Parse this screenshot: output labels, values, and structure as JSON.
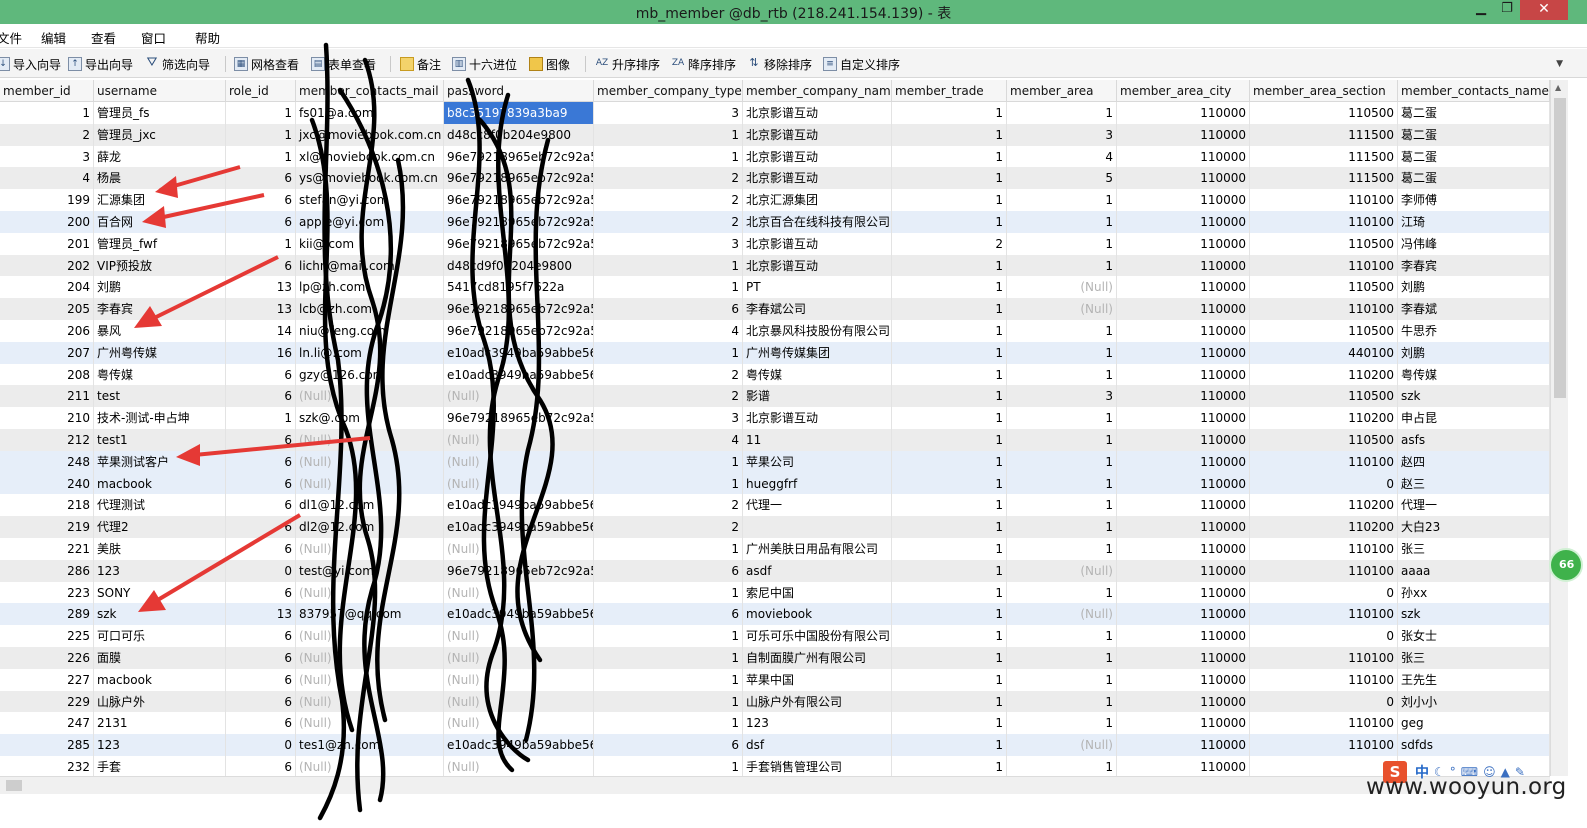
{
  "window": {
    "title": "mb_member @db_rtb (218.241.154.139) - 表",
    "min_label": "▁",
    "max_label": "❐",
    "close_label": "✕"
  },
  "menu": [
    "文件",
    "编辑",
    "查看",
    "窗口",
    "帮助"
  ],
  "toolbar": {
    "items": [
      "导入向导",
      "导出向导",
      "筛选向导",
      "网格查看",
      "表单查看",
      "备注",
      "十六进位",
      "图像",
      "升序排序",
      "降序排序",
      "移除排序",
      "自定义排序"
    ]
  },
  "columns": [
    "member_id",
    "username",
    "role_id",
    "member_contacts_mail",
    "password",
    "member_company_type",
    "member_company_name",
    "member_trade",
    "member_area",
    "member_area_city",
    "member_area_section",
    "member_contacts_name"
  ],
  "rows": [
    [
      "1",
      "管理员_fs",
      "1",
      "fs01@a.com",
      "b8c35197839a3ba9",
      "3",
      "北京影谱互动",
      "1",
      "1",
      "110000",
      "110500",
      "葛二蛋"
    ],
    [
      "2",
      "管理员_jxc",
      "1",
      "jxc@moviebook.com.cn",
      "d48cc8f0b204e9800",
      "1",
      "北京影谱互动",
      "1",
      "3",
      "110000",
      "111500",
      "葛二蛋"
    ],
    [
      "3",
      "薛龙",
      "1",
      "xl@moviebook.com.cn",
      "96e79218965eb72c92a54",
      "1",
      "北京影谱互动",
      "1",
      "4",
      "110000",
      "111500",
      "葛二蛋"
    ],
    [
      "4",
      "杨晨",
      "6",
      "ys@moviebook.com.cn",
      "96e79218965eb72c92a54",
      "2",
      "北京影谱互动",
      "1",
      "5",
      "110000",
      "111500",
      "葛二蛋"
    ],
    [
      "199",
      "汇源集团",
      "6",
      "stefan@yi.com",
      "96e79218965eb72c92a54",
      "2",
      " 北京汇源集团",
      "1",
      "1",
      "110000",
      "110100",
      "李师傅"
    ],
    [
      "200",
      "百合网",
      "6",
      "apple@yi.com",
      "96e79218965eb72c92a54",
      "2",
      "北京百合在线科技有限公司",
      "1",
      "1",
      "110000",
      "110100",
      "江琦"
    ],
    [
      "201",
      "管理员_fwf",
      "1",
      "kii@.com",
      "96e79218965eb72c92a54",
      "3",
      "北京影谱互动",
      "2",
      "1",
      "110000",
      "110500",
      "冯伟峰"
    ],
    [
      "202",
      "VIP预投放",
      "6",
      "lichn@mail.com",
      "d48cd9f0b204e9800",
      "1",
      "北京影谱互动",
      "1",
      "1",
      "110000",
      "110100",
      "李春宾"
    ],
    [
      "204",
      "刘鹏",
      "13",
      "lp@zh.com",
      "5417cd8195f7622a",
      "1",
      "PT",
      "1",
      "(Null)",
      "110000",
      "110500",
      "刘鹏"
    ],
    [
      "205",
      "李春宾",
      "13",
      "lcb@zh.com",
      "96e79218965eb72c92a54",
      "6",
      "李春斌公司",
      "1",
      "(Null)",
      "110000",
      "110100",
      "李春斌"
    ],
    [
      "206",
      "暴风",
      "14",
      "niu@feng.com",
      "96e79218965eb72c92a54",
      "4",
      " 北京暴风科技股份有限公司",
      "1",
      "1",
      "110000",
      "110500",
      "牛思乔"
    ],
    [
      "207",
      "广州粤传媒",
      "16",
      "ln.li@.com",
      "e10adc3949ba59abbe56e",
      "1",
      "广州粤传媒集团",
      "1",
      "1",
      "110000",
      "440100",
      "刘鹏"
    ],
    [
      "208",
      "粤传媒",
      "6",
      "gzy@126.com",
      "e10adc3949ba59abbe56e",
      "2",
      "粤传媒",
      "1",
      "1",
      "110000",
      "110200",
      "粤传媒"
    ],
    [
      "211",
      "test",
      "6",
      "(Null)",
      "(Null)",
      "2",
      "影谱",
      "1",
      "3",
      "110000",
      "110500",
      "szk"
    ],
    [
      "210",
      "技术-测试-申占坤",
      "1",
      "szk@.com",
      "96e79218965eb72c92a54",
      "3",
      "北京影谱互动",
      "1",
      "1",
      "110000",
      "110200",
      "申占昆"
    ],
    [
      "212",
      "test1",
      "6",
      "(Null)",
      "(Null)",
      "4",
      "11",
      "1",
      "1",
      "110000",
      "110500",
      "asfs"
    ],
    [
      "248",
      "苹果测试客户",
      "6",
      "(Null)",
      "(Null)",
      "1",
      "苹果公司",
      "1",
      "1",
      "110000",
      "110100",
      "赵四"
    ],
    [
      "240",
      "macbook",
      "6",
      "(Null)",
      "(Null)",
      "1",
      "hueggfrf",
      "1",
      "1",
      "110000",
      "0",
      "赵三"
    ],
    [
      "218",
      "代理测试",
      "6",
      "dl1@12.com",
      "e10adc3949ba59abbe56e",
      "2",
      "代理一",
      "1",
      "1",
      "110000",
      "110200",
      "代理一"
    ],
    [
      "219",
      "代理2",
      "6",
      "dl2@12.com",
      "e10adc3949ba59abbe56e",
      "2",
      "",
      "1",
      "1",
      "110000",
      "110200",
      "大白23"
    ],
    [
      "221",
      "美肤",
      "6",
      "(Null)",
      "(Null)",
      "1",
      "广州美肤日用品有限公司",
      "1",
      "1",
      "110000",
      "110100",
      "张三"
    ],
    [
      "286",
      "123",
      "0",
      "test@yi.com",
      "96e79218965eb72c92a54",
      "6",
      "asdf",
      "1",
      "(Null)",
      "110000",
      "110100",
      "aaaa"
    ],
    [
      "223",
      "SONY",
      "6",
      "(Null)",
      "(Null)",
      "1",
      "索尼中国",
      "1",
      "1",
      "110000",
      "0",
      "孙xx"
    ],
    [
      "289",
      "szk",
      "13",
      "837957@qq.com",
      "e10adc3949ba59abbe56e",
      "6",
      "moviebook",
      "1",
      "(Null)",
      "110000",
      "110100",
      "szk"
    ],
    [
      "225",
      "可口可乐",
      "6",
      "(Null)",
      "(Null)",
      "1",
      "可乐可乐中国股份有限公司",
      "1",
      "1",
      "110000",
      "0",
      "张女士"
    ],
    [
      "226",
      "面膜",
      "6",
      "(Null)",
      "(Null)",
      "1",
      "自制面膜广州有限公司",
      "1",
      "1",
      "110000",
      "110100",
      "张三"
    ],
    [
      "227",
      "macbook",
      "6",
      "(Null)",
      "(Null)",
      "1",
      "苹果中国",
      "1",
      "1",
      "110000",
      "110100",
      "王先生"
    ],
    [
      "229",
      "山脉户外",
      "6",
      "(Null)",
      "(Null)",
      "1",
      "山脉户外有限公司",
      "1",
      "1",
      "110000",
      "0",
      "刘小小"
    ],
    [
      "247",
      "2131",
      "6",
      "(Null)",
      "(Null)",
      "1",
      "123",
      "1",
      "1",
      "110000",
      "110100",
      "geg"
    ],
    [
      "285",
      "123",
      "0",
      "tes1@zh.com",
      "e10adc3949ba59abbe56e",
      "6",
      "dsf",
      "1",
      "(Null)",
      "110000",
      "110100",
      "sdfds"
    ],
    [
      "232",
      "手套",
      "6",
      "(Null)",
      "(Null)",
      "1",
      "手套销售管理公司",
      "1",
      "1",
      "110000",
      "",
      ""
    ]
  ],
  "badge": "66",
  "ime": {
    "s": "S",
    "lang": "中"
  },
  "watermark": "www.wooyun.org",
  "colors": {
    "titlebar": "#5fb87c",
    "selection": "#3a78d6",
    "arrow": "#e53935",
    "scribble": "#000000"
  }
}
